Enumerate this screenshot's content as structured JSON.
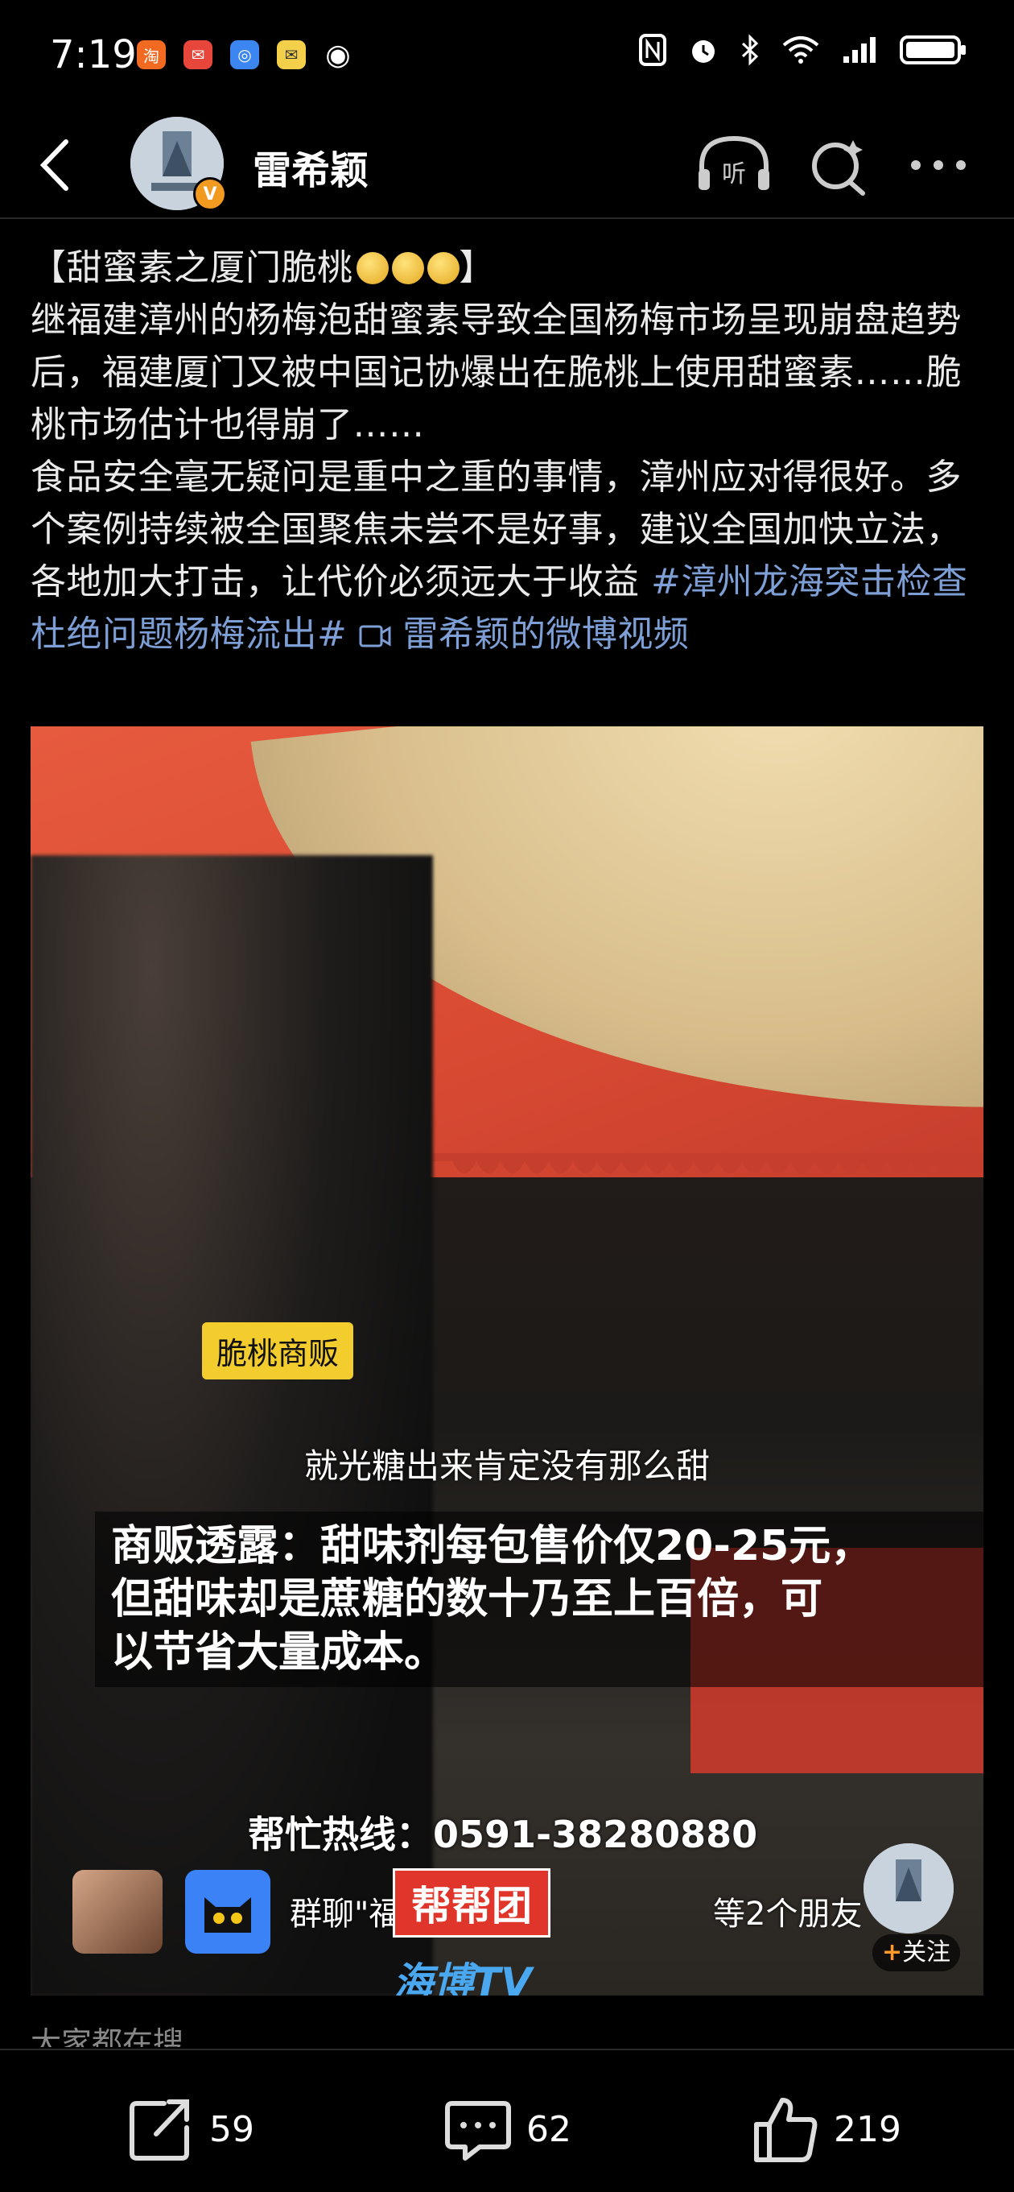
{
  "status_bar": {
    "time": "7:19",
    "notification_icons": [
      "taobao-icon",
      "mail-icon",
      "browser-icon",
      "message-icon",
      "eye-icon"
    ],
    "system_icons": [
      "nfc-icon",
      "alarm-icon",
      "bluetooth-icon",
      "wifi-icon",
      "signal-icon",
      "battery-icon"
    ]
  },
  "header": {
    "username": "雷希颖",
    "badge": "V",
    "listen_label": "听"
  },
  "post": {
    "title": "【甜蜜素之厦门脆桃",
    "paragraph1": "继福建漳州的杨梅泡甜蜜素导致全国杨梅市场呈现崩盘趋势后，福建厦门又被中国记协爆出在脆桃上使用甜蜜素……脆桃市场估计也得崩了……",
    "paragraph2_text": "食品安全毫无疑问是重中之重的事情，漳州应对得很好。多个案例持续被全国聚焦未尝不是好事，建议全国加快立法，各地加大打击，让代价必须远大于收益 ",
    "hashtag": "#漳州龙海突击检查杜绝问题杨梅流出#",
    "video_link": " 雷希颖的微博视频"
  },
  "video": {
    "tag_label": "脆桃商贩",
    "subtitle": "就光糖出来肯定没有那么甜",
    "caption_line1": "商贩透露：甜味剂每包售价仅20-25元，",
    "caption_line2": "但甜味却是蔗糖的数十乃至上百倍，可",
    "caption_line3": "以节省大量成本。",
    "hotline": "帮忙热线：0591-38280880",
    "group_text": "群聊\"福…联盟…",
    "brand_logo": "帮帮团",
    "friends_text": "等2个朋友",
    "channel_logo": "海博TV",
    "follow_plus": "+",
    "follow_label": "关注"
  },
  "search_section_label": "大家都在搜",
  "actions": {
    "share_count": "59",
    "comment_count": "62",
    "like_count": "219"
  },
  "colors": {
    "link": "#7e9fd6",
    "tag_yellow": "#f3cc2e",
    "badge_orange": "#f29a1f"
  }
}
